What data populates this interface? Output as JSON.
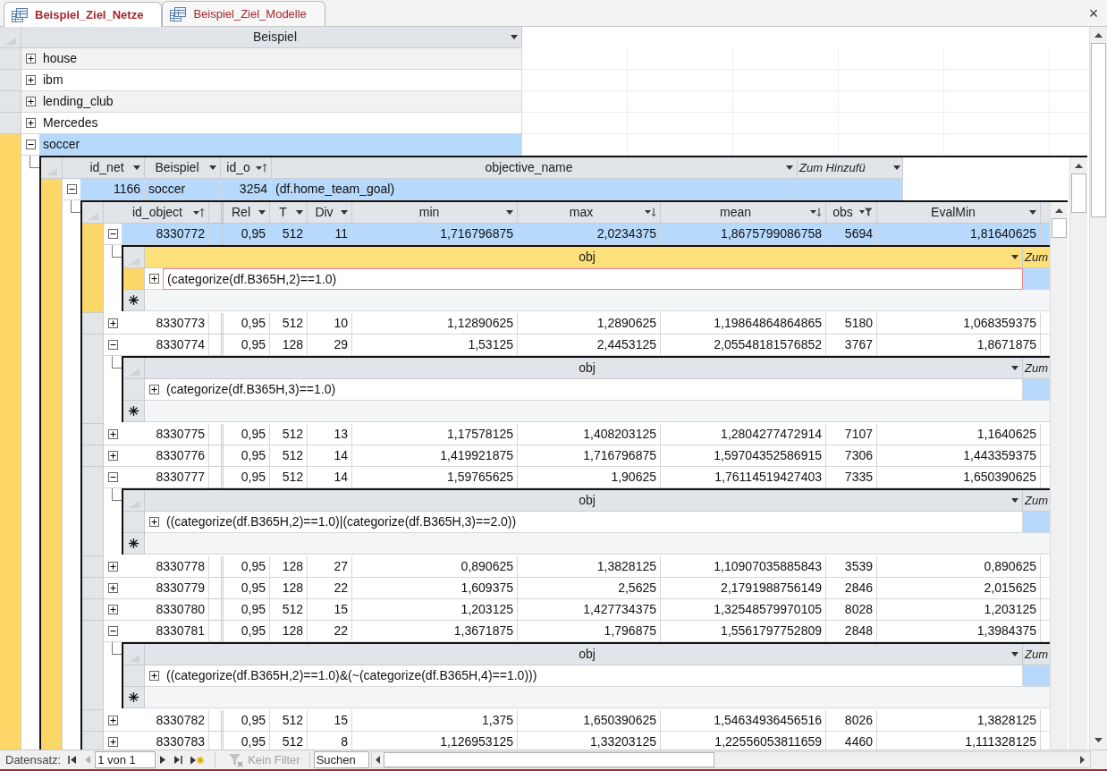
{
  "tabs": [
    {
      "label": "Beispiel_Ziel_Netze",
      "selected": true
    },
    {
      "label": "Beispiel_Ziel_Modelle",
      "selected": false
    }
  ],
  "close_button": "×",
  "table": {
    "columns": [
      {
        "label": "Beispiel",
        "kind": "data",
        "numeric": false,
        "menu": true,
        "sort_ascending": false,
        "sort_descending": false,
        "filtered": false
      }
    ],
    "rows": [
      {
        "cells": [
          "house"
        ],
        "expanded": false,
        "selected": false
      },
      {
        "cells": [
          "ibm"
        ],
        "expanded": false,
        "selected": false
      },
      {
        "cells": [
          "lending_club"
        ],
        "expanded": false,
        "selected": false
      },
      {
        "cells": [
          "Mercedes"
        ],
        "expanded": false,
        "selected": false
      },
      {
        "cells": [
          "soccer"
        ],
        "expanded": true,
        "selected": true,
        "subtable": {
          "columns": [
            {
              "label": "id_net",
              "kind": "data",
              "numeric": true,
              "menu": true,
              "sort_ascending": false,
              "sort_descending": false,
              "filtered": false
            },
            {
              "label": "Beispiel",
              "kind": "data",
              "numeric": false,
              "menu": true,
              "sort_ascending": false,
              "sort_descending": false,
              "filtered": false
            },
            {
              "label": "id_o",
              "kind": "data",
              "numeric": true,
              "menu": true,
              "sort_ascending": true,
              "sort_descending": false,
              "filtered": false
            },
            {
              "label": "objective_name",
              "kind": "data",
              "numeric": false,
              "menu": true,
              "sort_ascending": false,
              "sort_descending": false,
              "filtered": false
            },
            {
              "label": "Zum Hinzufü",
              "kind": "add",
              "menu": true
            }
          ],
          "rows": [
            {
              "cells": [
                "1166",
                "soccer",
                "3254",
                "(df.home_team_goal)"
              ],
              "expanded": true,
              "selected": true,
              "subtable": {
                "columns": [
                  {
                    "label": "id_object",
                    "kind": "data",
                    "numeric": true,
                    "menu": true,
                    "sort_ascending": true,
                    "sort_descending": false,
                    "filtered": false
                  },
                  {
                    "label": "Rel",
                    "kind": "data",
                    "numeric": true,
                    "menu": true,
                    "sort_ascending": false,
                    "sort_descending": false,
                    "filtered": false
                  },
                  {
                    "label": "T",
                    "kind": "data",
                    "numeric": true,
                    "menu": true,
                    "sort_ascending": false,
                    "sort_descending": false,
                    "filtered": false
                  },
                  {
                    "label": "Div",
                    "kind": "data",
                    "numeric": true,
                    "menu": true,
                    "sort_ascending": false,
                    "sort_descending": false,
                    "filtered": false
                  },
                  {
                    "label": "min",
                    "kind": "data",
                    "numeric": true,
                    "menu": true,
                    "sort_ascending": false,
                    "sort_descending": false,
                    "filtered": false
                  },
                  {
                    "label": "max",
                    "kind": "data",
                    "numeric": true,
                    "menu": true,
                    "sort_ascending": false,
                    "sort_descending": true,
                    "filtered": false
                  },
                  {
                    "label": "mean",
                    "kind": "data",
                    "numeric": true,
                    "menu": true,
                    "sort_ascending": false,
                    "sort_descending": true,
                    "filtered": false
                  },
                  {
                    "label": "obs",
                    "kind": "data",
                    "numeric": true,
                    "menu": true,
                    "sort_ascending": false,
                    "sort_descending": false,
                    "filtered": true
                  },
                  {
                    "label": "EvalMin",
                    "kind": "data",
                    "numeric": true,
                    "menu": true,
                    "sort_ascending": false,
                    "sort_descending": false,
                    "filtered": false
                  }
                ],
                "rows": [
                  {
                    "cells": [
                      "8330772",
                      "0,95",
                      "512",
                      "11",
                      "1,716796875",
                      "2,0234375",
                      "1,8675799086758",
                      "5694",
                      "1,81640625"
                    ],
                    "expanded": true,
                    "selected": true,
                    "subtable": {
                      "active": true,
                      "columns": [
                        {
                          "label": "obj",
                          "kind": "data",
                          "numeric": false,
                          "menu": true,
                          "sort_ascending": false,
                          "sort_descending": false,
                          "filtered": false
                        },
                        {
                          "label": "Zum",
                          "kind": "add",
                          "menu": false
                        }
                      ],
                      "rows": [
                        {
                          "cells": [
                            "(categorize(df.B365H,2)==1.0)"
                          ],
                          "expanded": false,
                          "selected": true
                        }
                      ]
                    }
                  },
                  {
                    "cells": [
                      "8330773",
                      "0,95",
                      "512",
                      "10",
                      "1,12890625",
                      "1,2890625",
                      "1,19864864864865",
                      "5180",
                      "1,068359375"
                    ],
                    "expanded": false,
                    "selected": false
                  },
                  {
                    "cells": [
                      "8330774",
                      "0,95",
                      "128",
                      "29",
                      "1,53125",
                      "2,4453125",
                      "2,05548181576852",
                      "3767",
                      "1,8671875"
                    ],
                    "expanded": true,
                    "selected": false,
                    "subtable": {
                      "active": false,
                      "columns": [
                        {
                          "label": "obj",
                          "kind": "data",
                          "numeric": false,
                          "menu": true,
                          "sort_ascending": false,
                          "sort_descending": false,
                          "filtered": false
                        },
                        {
                          "label": "Zum",
                          "kind": "add",
                          "menu": false
                        }
                      ],
                      "rows": [
                        {
                          "cells": [
                            "(categorize(df.B365H,3)==1.0)"
                          ],
                          "expanded": false,
                          "selected": false
                        }
                      ]
                    }
                  },
                  {
                    "cells": [
                      "8330775",
                      "0,95",
                      "512",
                      "13",
                      "1,17578125",
                      "1,408203125",
                      "1,2804277472914",
                      "7107",
                      "1,1640625"
                    ],
                    "expanded": false,
                    "selected": false
                  },
                  {
                    "cells": [
                      "8330776",
                      "0,95",
                      "512",
                      "14",
                      "1,419921875",
                      "1,716796875",
                      "1,59704352586915",
                      "7306",
                      "1,443359375"
                    ],
                    "expanded": false,
                    "selected": false
                  },
                  {
                    "cells": [
                      "8330777",
                      "0,95",
                      "512",
                      "14",
                      "1,59765625",
                      "1,90625",
                      "1,76114519427403",
                      "7335",
                      "1,650390625"
                    ],
                    "expanded": true,
                    "selected": false,
                    "subtable": {
                      "active": false,
                      "columns": [
                        {
                          "label": "obj",
                          "kind": "data",
                          "numeric": false,
                          "menu": true,
                          "sort_ascending": false,
                          "sort_descending": false,
                          "filtered": false
                        },
                        {
                          "label": "Zum",
                          "kind": "add",
                          "menu": false
                        }
                      ],
                      "rows": [
                        {
                          "cells": [
                            "((categorize(df.B365H,2)==1.0)|(categorize(df.B365H,3)==2.0))"
                          ],
                          "expanded": false,
                          "selected": false
                        }
                      ]
                    }
                  },
                  {
                    "cells": [
                      "8330778",
                      "0,95",
                      "128",
                      "27",
                      "0,890625",
                      "1,3828125",
                      "1,10907035885843",
                      "3539",
                      "0,890625"
                    ],
                    "expanded": false,
                    "selected": false
                  },
                  {
                    "cells": [
                      "8330779",
                      "0,95",
                      "128",
                      "22",
                      "1,609375",
                      "2,5625",
                      "2,1791988756149",
                      "2846",
                      "2,015625"
                    ],
                    "expanded": false,
                    "selected": false
                  },
                  {
                    "cells": [
                      "8330780",
                      "0,95",
                      "512",
                      "15",
                      "1,203125",
                      "1,427734375",
                      "1,32548579970105",
                      "8028",
                      "1,203125"
                    ],
                    "expanded": false,
                    "selected": false
                  },
                  {
                    "cells": [
                      "8330781",
                      "0,95",
                      "128",
                      "22",
                      "1,3671875",
                      "1,796875",
                      "1,5561797752809",
                      "2848",
                      "1,3984375"
                    ],
                    "expanded": true,
                    "selected": false,
                    "subtable": {
                      "active": false,
                      "columns": [
                        {
                          "label": "obj",
                          "kind": "data",
                          "numeric": false,
                          "menu": true,
                          "sort_ascending": false,
                          "sort_descending": false,
                          "filtered": false
                        },
                        {
                          "label": "Zum",
                          "kind": "add",
                          "menu": false
                        }
                      ],
                      "rows": [
                        {
                          "cells": [
                            "((categorize(df.B365H,2)==1.0)&(~(categorize(df.B365H,4)==1.0)))"
                          ],
                          "expanded": false,
                          "selected": false
                        }
                      ]
                    }
                  },
                  {
                    "cells": [
                      "8330782",
                      "0,95",
                      "512",
                      "15",
                      "1,375",
                      "1,650390625",
                      "1,54634936456516",
                      "8026",
                      "1,3828125"
                    ],
                    "expanded": false,
                    "selected": false
                  },
                  {
                    "cells": [
                      "8330783",
                      "0,95",
                      "512",
                      "8",
                      "1,126953125",
                      "1,33203125",
                      "1,22556053811659",
                      "4460",
                      "1,111328125"
                    ],
                    "expanded": false,
                    "selected": false
                  }
                ]
              }
            }
          ]
        }
      }
    ]
  },
  "status_bar": {
    "label": "Datensatz:",
    "record": "1 von 1",
    "navigation": [
      {
        "kind": "first",
        "disabled": false
      },
      {
        "kind": "prev",
        "disabled": true
      },
      {
        "kind": "next",
        "disabled": false
      },
      {
        "kind": "last",
        "disabled": false
      },
      {
        "kind": "new",
        "disabled": false
      }
    ],
    "filter": {
      "label": "Kein Filter",
      "disabled": true
    },
    "search": {
      "placeholder": "Suchen"
    }
  }
}
